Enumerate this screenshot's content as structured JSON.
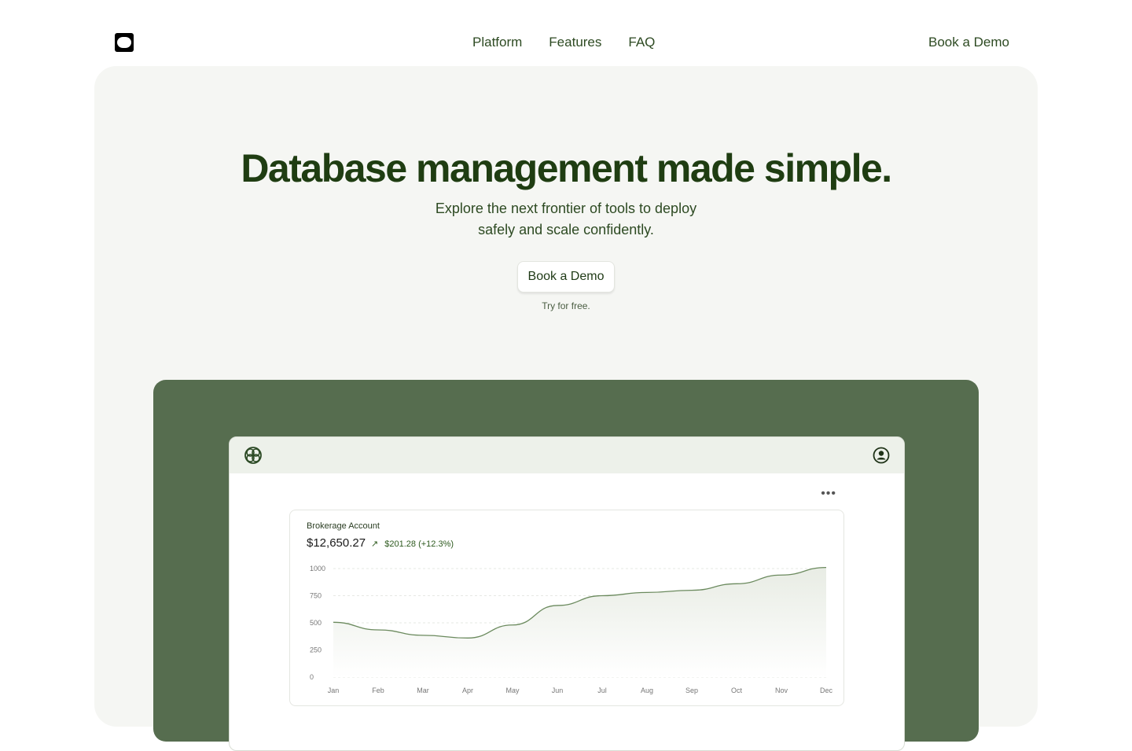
{
  "nav": {
    "links": [
      "Platform",
      "Features",
      "FAQ"
    ],
    "cta": "Book a Demo"
  },
  "hero": {
    "title": "Database management made simple.",
    "subtitle_line1": "Explore the next frontier of tools to deploy",
    "subtitle_line2": "safely and scale confidently.",
    "button": "Book a Demo",
    "note": "Try for free."
  },
  "app": {
    "card_title": "Brokerage Account",
    "amount": "$12,650.27",
    "change": "$201.28 (+12.3%)",
    "change_icon": "arrow-up-right-icon"
  },
  "chart_data": {
    "type": "area",
    "categories": [
      "Jan",
      "Feb",
      "Mar",
      "Apr",
      "May",
      "Jun",
      "Jul",
      "Aug",
      "Sep",
      "Oct",
      "Nov",
      "Dec"
    ],
    "values": [
      505,
      435,
      385,
      360,
      480,
      660,
      750,
      780,
      800,
      860,
      940,
      1010
    ],
    "yticks": [
      0,
      250,
      500,
      750,
      1000
    ],
    "ylim": [
      0,
      1000
    ],
    "grid": true,
    "line_color": "#6b8a5e",
    "fill_color": "#e8ece4"
  }
}
